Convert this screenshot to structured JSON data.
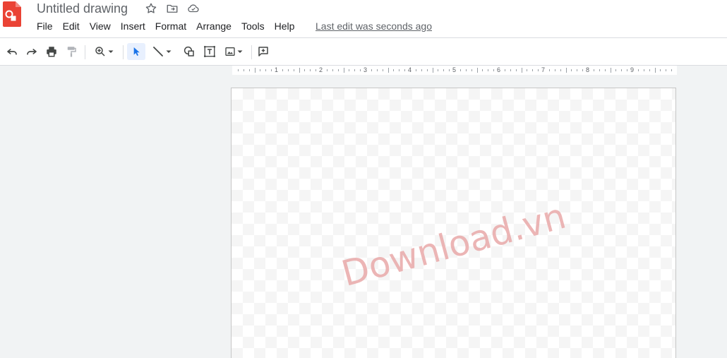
{
  "header": {
    "title": "Untitled drawing",
    "last_edit": "Last edit was seconds ago",
    "icons": [
      "star-icon",
      "move-to-folder-icon",
      "cloud-saved-icon"
    ]
  },
  "menu": [
    "File",
    "Edit",
    "View",
    "Insert",
    "Format",
    "Arrange",
    "Tools",
    "Help"
  ],
  "toolbar": {
    "buttons": [
      "undo-icon",
      "redo-icon",
      "print-icon",
      "paint-format-icon",
      "zoom-icon",
      "select-icon",
      "line-icon",
      "shape-icon",
      "text-box-icon",
      "image-icon",
      "comment-icon"
    ],
    "active": "select"
  },
  "ruler": {
    "labels": [
      "1",
      "2",
      "3",
      "4",
      "5",
      "6",
      "7",
      "8",
      "9"
    ]
  },
  "canvas": {
    "watermark": "Download.vn"
  },
  "colors": {
    "brand": "#ea4335",
    "accent": "#1a73e8",
    "watermark": "#e9a9a9"
  }
}
